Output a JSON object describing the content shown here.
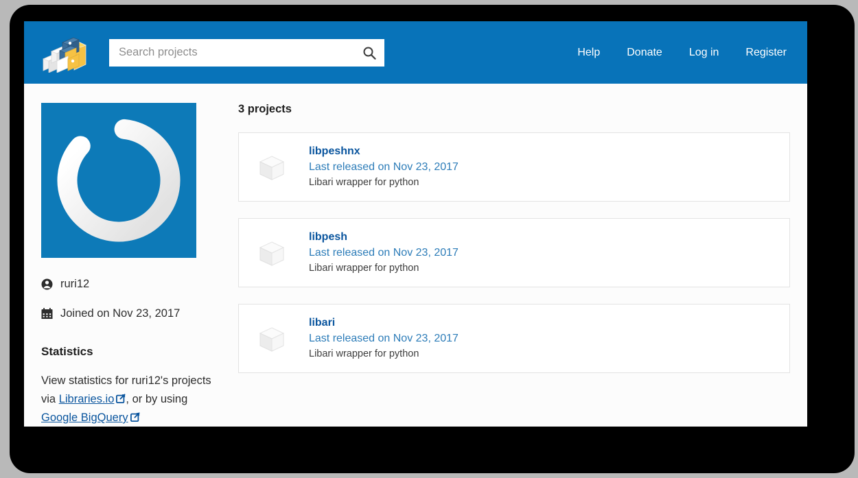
{
  "header": {
    "logo_icon": "pypi-cubes-logo",
    "search": {
      "placeholder": "Search projects",
      "value": "",
      "icon": "search-icon"
    },
    "nav": [
      {
        "label": "Help"
      },
      {
        "label": "Donate"
      },
      {
        "label": "Log in"
      },
      {
        "label": "Register"
      }
    ]
  },
  "sidebar": {
    "avatar_icon": "gravatar-power-logo",
    "username": "ruri12",
    "username_icon": "user-circle-icon",
    "joined": "Joined on Nov 23, 2017",
    "joined_icon": "calendar-icon",
    "statistics": {
      "title": "Statistics",
      "text_before": "View statistics for ruri12's projects via ",
      "link1": "Libraries.io",
      "text_middle": ", or by using ",
      "link2": "Google BigQuery",
      "external_icon": "external-link-icon"
    }
  },
  "main": {
    "projects_count": "3 projects",
    "projects": [
      {
        "name": "libpeshnx",
        "released": "Last released on Nov 23, 2017",
        "description": "Libari wrapper for python",
        "icon": "package-cube-icon"
      },
      {
        "name": "libpesh",
        "released": "Last released on Nov 23, 2017",
        "description": "Libari wrapper for python",
        "icon": "package-cube-icon"
      },
      {
        "name": "libari",
        "released": "Last released on Nov 23, 2017",
        "description": "Libari wrapper for python",
        "icon": "package-cube-icon"
      }
    ]
  },
  "colors": {
    "header_blue": "#0873b9",
    "link_blue": "#0a559e",
    "released_blue": "#2c7cb8",
    "avatar_blue": "#0d7ab8",
    "page_bg": "#fcfcfc",
    "card_border": "#e3e3e3",
    "bezel": "#000000",
    "desktop": "#b9b9b9"
  }
}
